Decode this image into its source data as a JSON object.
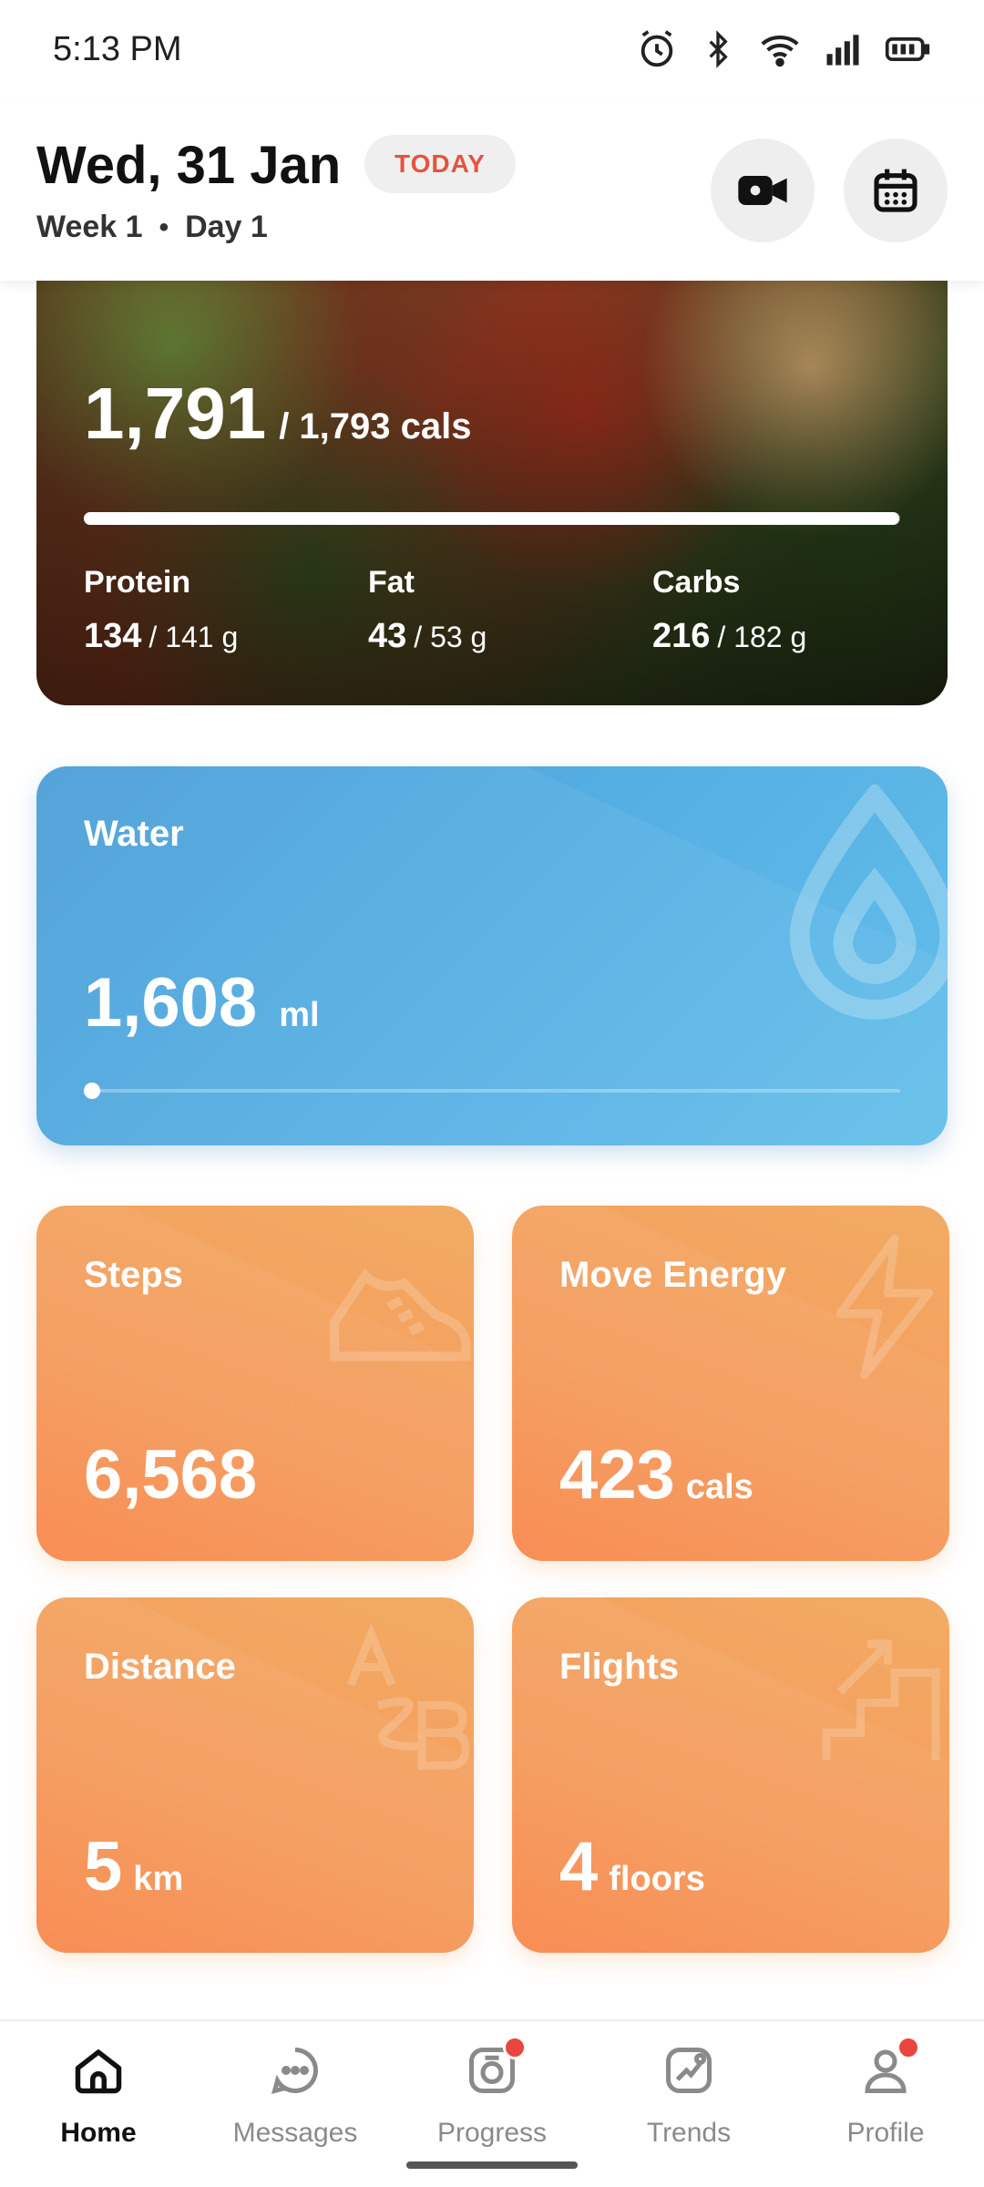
{
  "status_bar": {
    "time": "5:13 PM",
    "icons": [
      "alarm-icon",
      "bluetooth-icon",
      "wifi-icon",
      "signal-icon",
      "battery-icon"
    ]
  },
  "header": {
    "date": "Wed, 31 Jan",
    "today_badge": "TODAY",
    "week": "Week 1",
    "separator": "•",
    "day": "Day 1",
    "buttons": [
      "video-icon",
      "calendar-icon"
    ]
  },
  "calories": {
    "consumed": "1,791",
    "goal": "/ 1,793 cals",
    "progress_fraction": 0.999,
    "macros": [
      {
        "label": "Protein",
        "value": "134",
        "goal": "/ 141 g"
      },
      {
        "label": "Fat",
        "value": "43",
        "goal": "/ 53 g"
      },
      {
        "label": "Carbs",
        "value": "216",
        "goal": "/ 182 g"
      }
    ]
  },
  "water": {
    "title": "Water",
    "value": "1,608",
    "unit": "ml",
    "accent": "#55aee3"
  },
  "tiles": {
    "steps": {
      "title": "Steps",
      "value": "6,568",
      "unit": ""
    },
    "move_energy": {
      "title": "Move Energy",
      "value": "423",
      "unit": "cals"
    },
    "distance": {
      "title": "Distance",
      "value": "5",
      "unit": "km"
    },
    "flights": {
      "title": "Flights",
      "value": "4",
      "unit": "floors"
    },
    "accent": "#f59a5b"
  },
  "bottom_nav": {
    "items": [
      {
        "label": "Home",
        "icon": "home-icon",
        "active": true
      },
      {
        "label": "Messages",
        "icon": "messages-icon",
        "active": false
      },
      {
        "label": "Progress",
        "icon": "progress-icon",
        "active": false,
        "badge": true
      },
      {
        "label": "Trends",
        "icon": "trends-icon",
        "active": false
      },
      {
        "label": "Profile",
        "icon": "profile-icon",
        "active": false,
        "badge": true
      }
    ],
    "badge_color": "#e8463f"
  }
}
